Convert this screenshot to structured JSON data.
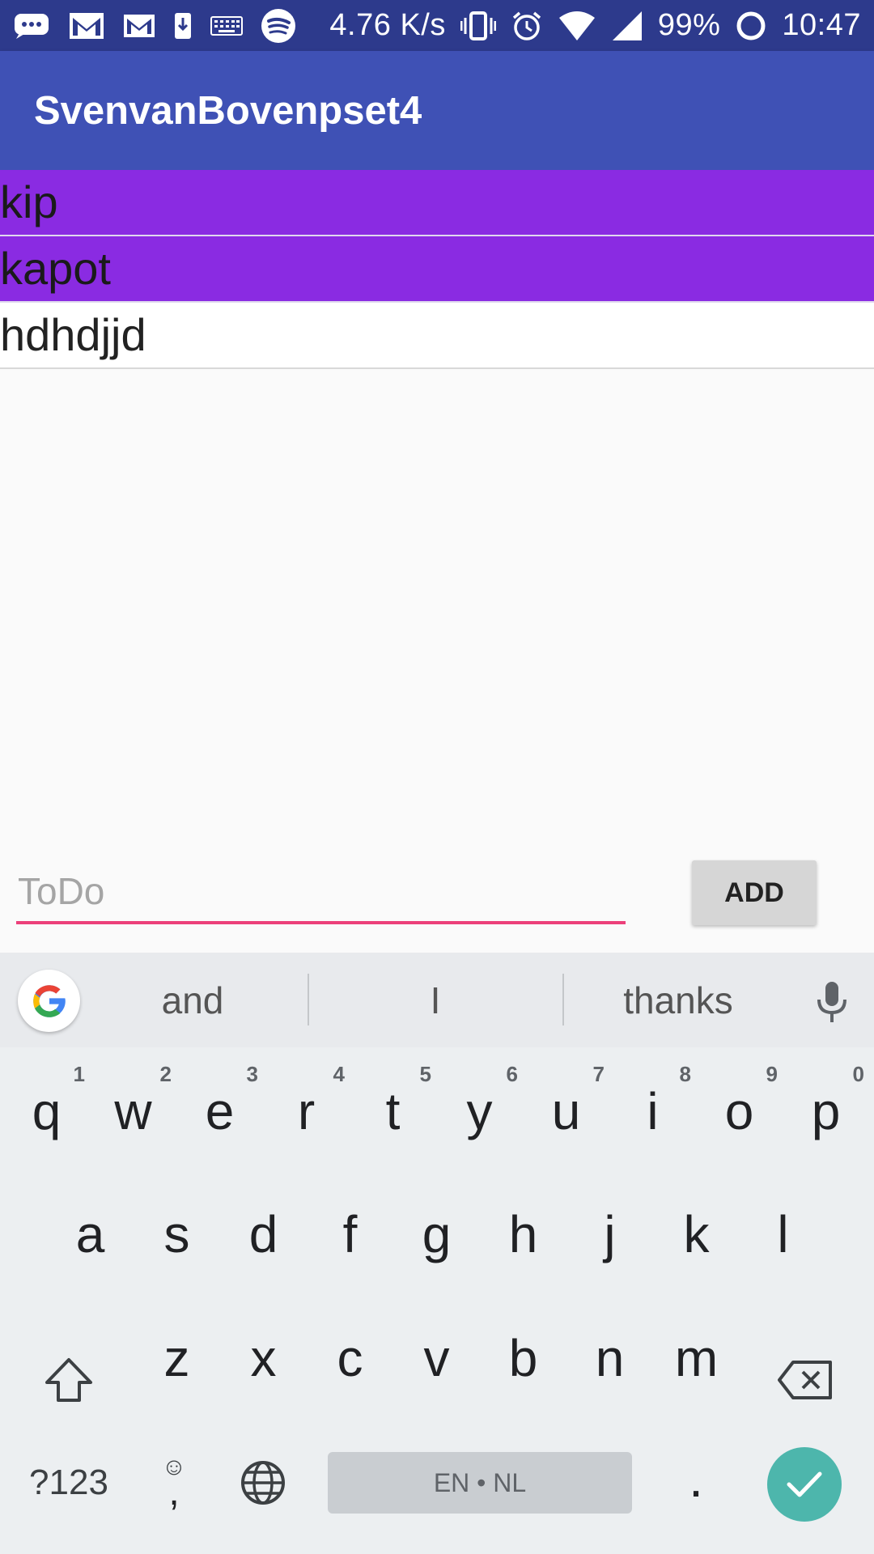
{
  "status_bar": {
    "speed": "4.76 K/s",
    "battery": "99%",
    "time": "10:47",
    "icons_left": [
      "chat-icon",
      "gmail-icon",
      "gmail-icon",
      "download-icon",
      "keyboard-icon",
      "spotify-icon"
    ],
    "icons_right": [
      "vibrate-icon",
      "alarm-icon",
      "wifi-icon",
      "signal-icon",
      "battery-ring-icon"
    ]
  },
  "app_bar": {
    "title": "SvenvanBovenpset4"
  },
  "todos": [
    {
      "label": "kip",
      "done": true
    },
    {
      "label": "kapot",
      "done": true
    },
    {
      "label": "hdhdjjd",
      "done": false
    }
  ],
  "input": {
    "placeholder": "ToDo",
    "value": ""
  },
  "add_button": {
    "label": "ADD"
  },
  "keyboard": {
    "suggestions": [
      "and",
      "I",
      "thanks"
    ],
    "row1": [
      {
        "k": "q",
        "h": "1"
      },
      {
        "k": "w",
        "h": "2"
      },
      {
        "k": "e",
        "h": "3"
      },
      {
        "k": "r",
        "h": "4"
      },
      {
        "k": "t",
        "h": "5"
      },
      {
        "k": "y",
        "h": "6"
      },
      {
        "k": "u",
        "h": "7"
      },
      {
        "k": "i",
        "h": "8"
      },
      {
        "k": "o",
        "h": "9"
      },
      {
        "k": "p",
        "h": "0"
      }
    ],
    "row2": [
      "a",
      "s",
      "d",
      "f",
      "g",
      "h",
      "j",
      "k",
      "l"
    ],
    "row3": [
      "z",
      "x",
      "c",
      "v",
      "b",
      "n",
      "m"
    ],
    "symbols_key": "?123",
    "comma_key": ",",
    "space_label": "EN • NL",
    "period_key": "."
  },
  "colors": {
    "status_bar": "#2d3a8c",
    "app_bar": "#3f51b5",
    "done_row": "#8a2be2",
    "input_underline": "#ec407a",
    "enter_key": "#4db6ac"
  }
}
